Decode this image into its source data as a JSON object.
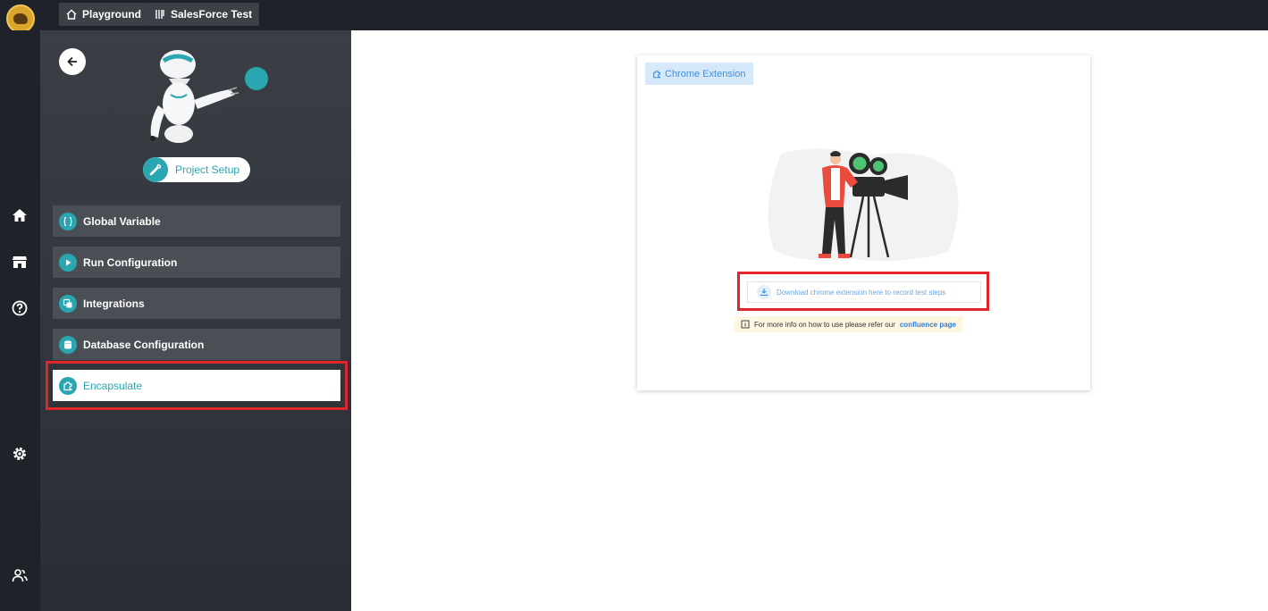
{
  "topbar": {
    "crumbs": [
      {
        "label": "Playground",
        "icon": "home-icon"
      },
      {
        "label": "SalesForce Test",
        "icon": "project-icon"
      }
    ]
  },
  "rail": {
    "icons": [
      "home-icon",
      "store-icon",
      "help-icon",
      "settings-icon",
      "users-icon"
    ]
  },
  "sidebar": {
    "project_setup_label": "Project Setup",
    "items": [
      {
        "label": "Global Variable",
        "icon": "braces-icon"
      },
      {
        "label": "Run Configuration",
        "icon": "play-icon"
      },
      {
        "label": "Integrations",
        "icon": "integrations-icon"
      },
      {
        "label": "Database Configuration",
        "icon": "database-icon"
      },
      {
        "label": "Encapsulate",
        "icon": "puzzle-icon",
        "active": true
      }
    ]
  },
  "main": {
    "tab_label": "Chrome Extension",
    "download_label": "Download chrome extension here to record test steps",
    "info_text": "For more info on how to use please refer our",
    "info_link": "confluence page"
  },
  "colors": {
    "accent": "#2aa6b1",
    "highlight": "#e0262b",
    "link": "#2f7fd6"
  }
}
